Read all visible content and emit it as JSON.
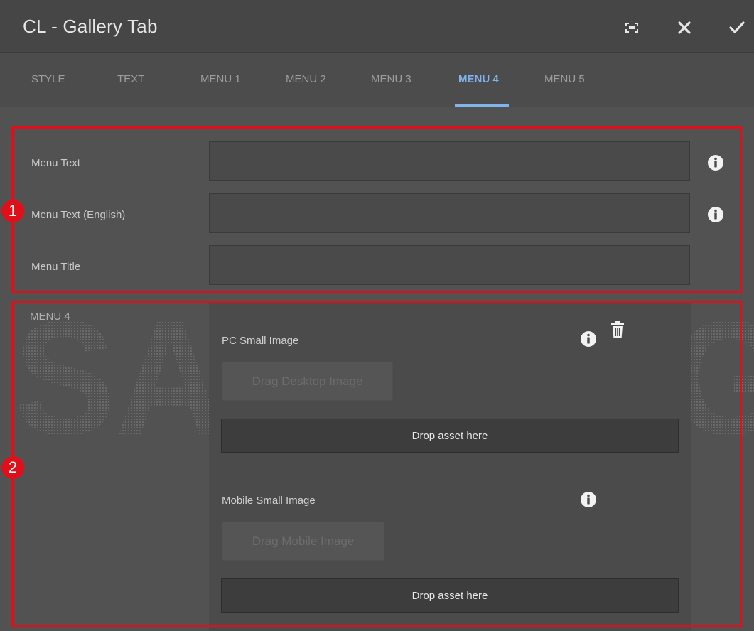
{
  "dialog": {
    "title": "CL - Gallery Tab",
    "header_icons": [
      "fullscreen-icon",
      "close-icon",
      "checkmark-icon"
    ]
  },
  "tabs": [
    {
      "label": "STYLE",
      "active": false
    },
    {
      "label": "TEXT",
      "active": false
    },
    {
      "label": "MENU 1",
      "active": false
    },
    {
      "label": "MENU 2",
      "active": false
    },
    {
      "label": "MENU 3",
      "active": false
    },
    {
      "label": "MENU 4",
      "active": true
    },
    {
      "label": "MENU 5",
      "active": false
    }
  ],
  "fields": {
    "menu_text": {
      "label": "Menu Text",
      "value": ""
    },
    "menu_text_en": {
      "label": "Menu Text (English)",
      "value": ""
    },
    "menu_title": {
      "label": "Menu Title",
      "value": ""
    }
  },
  "section": {
    "label": "MENU 4",
    "pc_image": {
      "label": "PC Small Image",
      "drag_label": "Drag Desktop Image",
      "drop_label": "Drop asset here"
    },
    "mobile_image": {
      "label": "Mobile Small Image",
      "drag_label": "Drag Mobile Image",
      "drop_label": "Drop asset here"
    }
  },
  "annotations": [
    "1",
    "2"
  ],
  "watermark_text": "SAMSUNG",
  "colors": {
    "accent": "#7fb4ec",
    "highlight": "#e0101a",
    "background": "#525252",
    "header": "#464646"
  }
}
